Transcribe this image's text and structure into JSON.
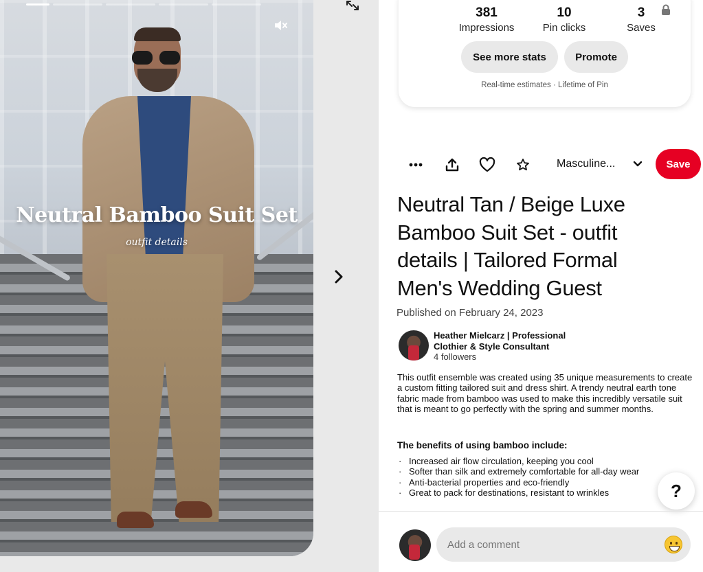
{
  "story": {
    "title": "Neutral Bamboo Suit Set",
    "subtitle": "outfit details",
    "progress_segments": 5,
    "active_segment": 1
  },
  "stats": {
    "impressions_value": "381",
    "impressions_label": "Impressions",
    "clicks_value": "10",
    "clicks_label": "Pin clicks",
    "saves_value": "3",
    "saves_label": "Saves",
    "see_more_label": "See more stats",
    "promote_label": "Promote",
    "estimates_note": "Real-time estimates · Lifetime of Pin"
  },
  "toolbar": {
    "board_name": "Masculine...",
    "save_label": "Save"
  },
  "pin": {
    "title": "Neutral Tan / Beige Luxe Bamboo Suit Set - outfit details | Tailored Formal Men's Wedding Guest",
    "published": "Published on February 24, 2023",
    "creator_name": "Heather Mielcarz | Professional Clothier & Style Consultant",
    "followers": "4 followers",
    "description": "This outfit ensemble was created using 35 unique measurements to create a custom fitting tailored suit and dress shirt. A trendy neutral earth tone fabric made from bamboo was used to make this incredibly versatile suit that is meant to go perfectly with the spring and summer months.",
    "benefits_heading": "The benefits of using bamboo include:",
    "benefits": [
      "Increased air flow circulation, keeping you cool",
      "Softer than silk and extremely comfortable for all-day wear",
      "Anti-bacterial properties and eco-friendly",
      "Great to pack for destinations, resistant to wrinkles"
    ]
  },
  "help_label": "?",
  "comment": {
    "placeholder": "Add a comment"
  },
  "colors": {
    "save_red": "#e60023",
    "pill_gray": "#e9e9e9"
  },
  "icons": [
    "mute-icon",
    "expand-icon",
    "chevron-right-icon",
    "more-icon",
    "share-icon",
    "heart-icon",
    "star-icon",
    "chevron-down-icon",
    "lock-icon",
    "emoji-icon"
  ]
}
